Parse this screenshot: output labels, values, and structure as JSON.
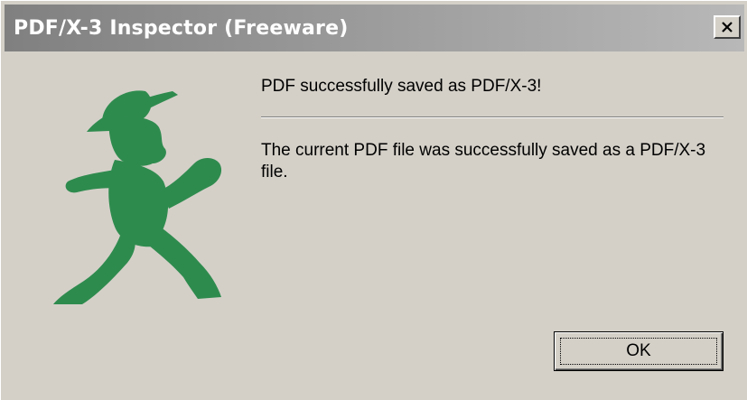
{
  "window": {
    "title": "PDF/X-3 Inspector (Freeware)",
    "close_icon": "close-icon"
  },
  "mascot": {
    "icon": "walking-man-icon",
    "color": "#2e8b4e"
  },
  "content": {
    "heading": "PDF successfully saved as PDF/X-3!",
    "message": "The current PDF file was successfully saved as a PDF/X-3 file."
  },
  "buttons": {
    "ok_label": "OK"
  },
  "colors": {
    "titlebar_start": "#808080",
    "titlebar_end": "#b8b8b8",
    "dialog_bg": "#d4d0c8"
  }
}
